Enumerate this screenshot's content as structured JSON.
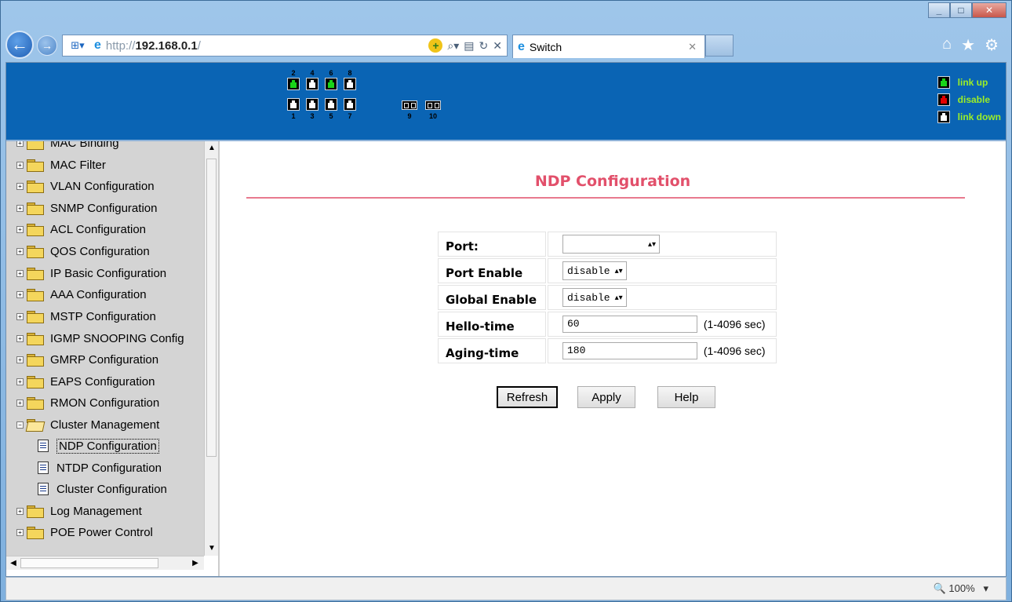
{
  "browser": {
    "url_prefix": "http://",
    "url_host": "192.168.0.1",
    "url_suffix": "/",
    "tab_title": "Switch",
    "zoom": "100%"
  },
  "banner": {
    "top_port_numbers": [
      "2",
      "4",
      "6",
      "8"
    ],
    "bottom_port_numbers": [
      "1",
      "3",
      "5",
      "7"
    ],
    "sfp_port_numbers": [
      "9",
      "10"
    ],
    "port_states": {
      "1": "down",
      "2": "up",
      "3": "down",
      "4": "down",
      "5": "down",
      "6": "up",
      "7": "down",
      "8": "down"
    },
    "legend": [
      {
        "state": "up",
        "label": "link up"
      },
      {
        "state": "disable",
        "label": "disable"
      },
      {
        "state": "down",
        "label": "link down"
      }
    ],
    "colors": {
      "link_up": "#19d419",
      "disable": "#e10000",
      "legend_text": "#9cee27",
      "banner_bg": "#0a64b4"
    }
  },
  "sidebar": {
    "items": [
      {
        "label": "MAC Binding",
        "type": "folder"
      },
      {
        "label": "MAC Filter",
        "type": "folder"
      },
      {
        "label": "VLAN Configuration",
        "type": "folder"
      },
      {
        "label": "SNMP Configuration",
        "type": "folder"
      },
      {
        "label": "ACL Configuration",
        "type": "folder"
      },
      {
        "label": "QOS Configuration",
        "type": "folder"
      },
      {
        "label": "IP Basic Configuration",
        "type": "folder"
      },
      {
        "label": "AAA Configuration",
        "type": "folder"
      },
      {
        "label": "MSTP Configuration",
        "type": "folder"
      },
      {
        "label": "IGMP SNOOPING Config",
        "type": "folder"
      },
      {
        "label": "GMRP Configuration",
        "type": "folder"
      },
      {
        "label": "EAPS Configuration",
        "type": "folder"
      },
      {
        "label": "RMON Configuration",
        "type": "folder"
      },
      {
        "label": "Cluster Management",
        "type": "folder-open"
      },
      {
        "label": "NDP Configuration",
        "type": "doc",
        "selected": true
      },
      {
        "label": "NTDP Configuration",
        "type": "doc"
      },
      {
        "label": "Cluster Configuration",
        "type": "doc"
      },
      {
        "label": "Log Management",
        "type": "folder"
      },
      {
        "label": "POE Power Control",
        "type": "folder"
      }
    ]
  },
  "main": {
    "title": "NDP Configuration",
    "title_color": "#e2506b",
    "fields": {
      "port": {
        "label": "Port:",
        "value": ""
      },
      "port_enable": {
        "label": "Port Enable",
        "value": "disable"
      },
      "global_enable": {
        "label": "Global Enable",
        "value": "disable"
      },
      "hello_time": {
        "label": "Hello-time",
        "value": "60",
        "range": "(1-4096 sec)"
      },
      "aging_time": {
        "label": "Aging-time",
        "value": "180",
        "range": "(1-4096 sec)"
      }
    },
    "buttons": {
      "refresh": "Refresh",
      "apply": "Apply",
      "help": "Help"
    }
  }
}
